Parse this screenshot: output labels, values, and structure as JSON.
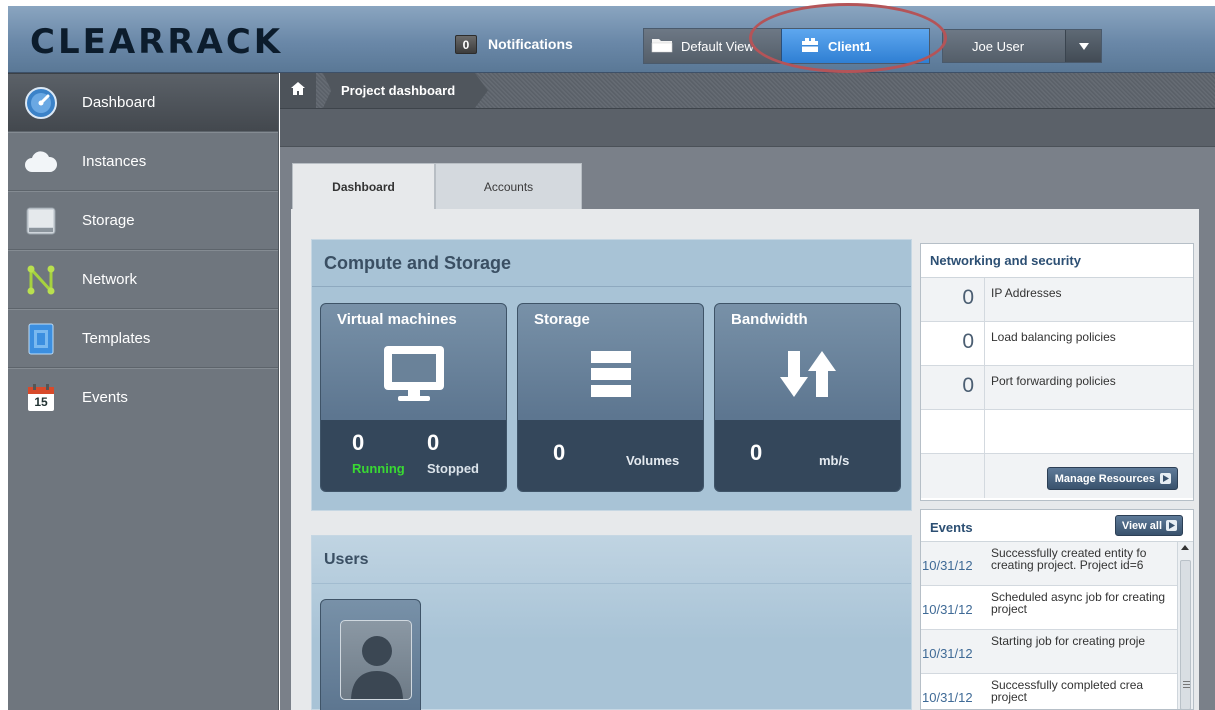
{
  "header": {
    "logo": "CLEARRACK",
    "notifications_count": "0",
    "notifications_label": "Notifications",
    "view_default_label": "Default View",
    "view_project_label": "Client1",
    "user_name": "Joe User"
  },
  "sidebar": {
    "items": [
      {
        "label": "Dashboard",
        "icon": "dashboard-gauge-icon"
      },
      {
        "label": "Instances",
        "icon": "cloud-icon"
      },
      {
        "label": "Storage",
        "icon": "disk-icon"
      },
      {
        "label": "Network",
        "icon": "network-icon"
      },
      {
        "label": "Templates",
        "icon": "template-icon"
      },
      {
        "label": "Events",
        "icon": "calendar-icon",
        "badge": "15"
      }
    ]
  },
  "breadcrumb": {
    "title": "Project dashboard"
  },
  "tabs": [
    {
      "label": "Dashboard"
    },
    {
      "label": "Accounts"
    }
  ],
  "compute": {
    "title": "Compute and Storage",
    "vm": {
      "title": "Virtual machines",
      "running": "0",
      "running_label": "Running",
      "stopped": "0",
      "stopped_label": "Stopped"
    },
    "storage": {
      "title": "Storage",
      "value": "0",
      "unit": "Volumes"
    },
    "bandwidth": {
      "title": "Bandwidth",
      "value": "0",
      "unit": "mb/s"
    }
  },
  "users": {
    "title": "Users"
  },
  "networking": {
    "title": "Networking and security",
    "rows": [
      {
        "count": "0",
        "label": "IP Addresses"
      },
      {
        "count": "0",
        "label": "Load balancing policies"
      },
      {
        "count": "0",
        "label": "Port forwarding policies"
      }
    ],
    "manage_label": "Manage Resources"
  },
  "events": {
    "title": "Events",
    "view_all_label": "View all",
    "items": [
      {
        "date": "10/31/12",
        "text": "Successfully created entity fo creating project. Project id=6"
      },
      {
        "date": "10/31/12",
        "text": "Scheduled async job for creating project"
      },
      {
        "date": "10/31/12",
        "text": "Starting job for creating proje"
      },
      {
        "date": "10/31/12",
        "text": "Successfully completed crea project"
      }
    ]
  },
  "colors": {
    "highlight_ellipse": "#b45458",
    "active_view": "#2f7fd3",
    "running_green": "#39d933"
  }
}
